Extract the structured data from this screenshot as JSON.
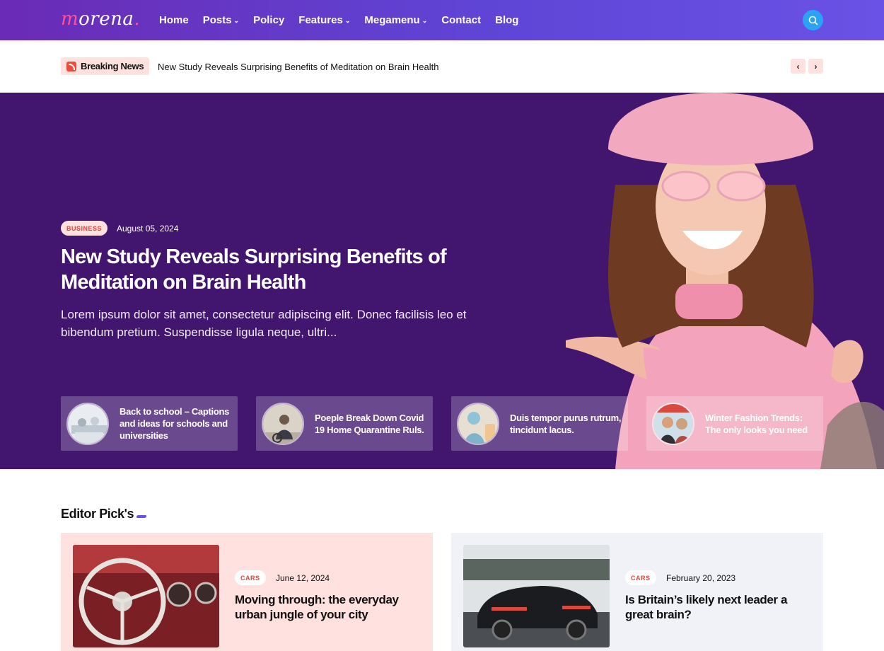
{
  "brand": {
    "name_first": "m",
    "name_rest": "orena",
    "name_dot": "."
  },
  "nav": {
    "items": [
      {
        "label": "Home",
        "dropdown": false
      },
      {
        "label": "Posts",
        "dropdown": true
      },
      {
        "label": "Policy",
        "dropdown": false
      },
      {
        "label": "Features",
        "dropdown": true
      },
      {
        "label": "Megamenu",
        "dropdown": true
      },
      {
        "label": "Contact",
        "dropdown": false
      },
      {
        "label": "Blog",
        "dropdown": false
      }
    ],
    "chevron": "⌄"
  },
  "breaking": {
    "label": "Breaking News",
    "headline": "New Study Reveals Surprising Benefits of Meditation on Brain Health",
    "prev": "‹",
    "next": "›"
  },
  "hero": {
    "category": "BUSINESS",
    "date": "August 05, 2024",
    "title": "New Study Reveals Surprising Benefits of Meditation on Brain Health",
    "excerpt": "Lorem ipsum dolor sit amet, consectetur adipiscing elit. Donec facilisis leo et bibendum pretium. Suspendisse ligula neque, ultri...",
    "mini_posts": [
      {
        "title": "Back to school – Captions and ideas for schools and universities"
      },
      {
        "title": "Poeple Break Down Covid 19 Home Quarantine Ruls."
      },
      {
        "title": "Duis tempor purus rutrum, tincidunt lacus."
      },
      {
        "title": "Winter Fashion Trends: The only looks you need"
      }
    ]
  },
  "editor_picks": {
    "title": "Editor Pick's",
    "items": [
      {
        "category": "CARS",
        "date": "June 12, 2024",
        "title": "Moving through: the everyday urban jungle of your city",
        "bg": "#ffe1df"
      },
      {
        "category": "CARS",
        "date": "February 20, 2023",
        "title": "Is Britain’s likely next leader a great brain?",
        "bg": "#f0f2f7"
      }
    ]
  },
  "colors": {
    "header": "#6a2bb5",
    "hero_bg": "#42166f",
    "accent": "#e2463c",
    "search": "#2aa3f5"
  },
  "icons": {
    "search": "search-icon",
    "breaking": "rss-icon"
  }
}
